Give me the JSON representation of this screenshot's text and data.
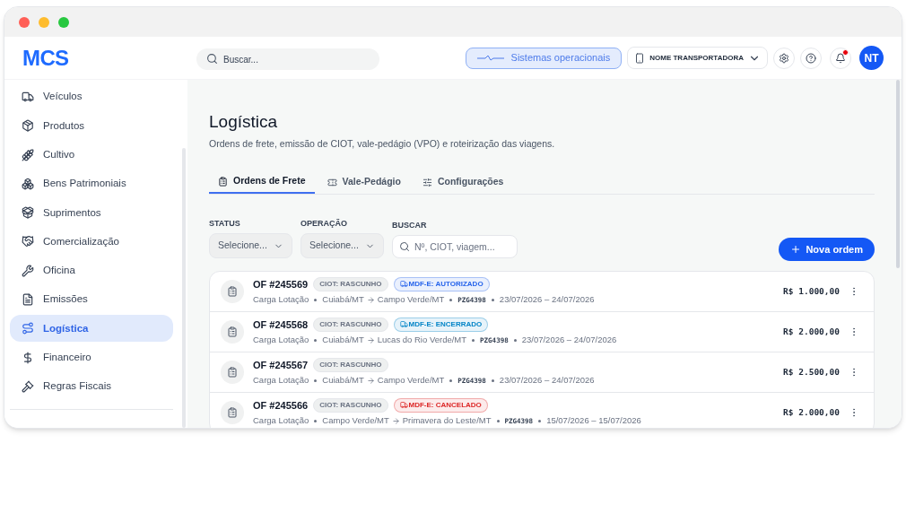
{
  "logo": "MCS",
  "header": {
    "search_placeholder": "Buscar...",
    "status_button": "Sistemas operacionais",
    "company": "NOME TRANSPORTADORA",
    "avatar": "NT",
    "has_notification": true
  },
  "sidebar": {
    "items": [
      {
        "label": "Veículos",
        "selected": false
      },
      {
        "label": "Produtos",
        "selected": false
      },
      {
        "label": "Cultivo",
        "selected": false
      },
      {
        "label": "Bens Patrimoniais",
        "selected": false
      },
      {
        "label": "Suprimentos",
        "selected": false
      },
      {
        "label": "Comercialização",
        "selected": false
      },
      {
        "label": "Oficina",
        "selected": false
      },
      {
        "label": "Emissões",
        "selected": false
      },
      {
        "label": "Logística",
        "selected": true
      },
      {
        "label": "Financeiro",
        "selected": false
      },
      {
        "label": "Regras Fiscais",
        "selected": false
      }
    ]
  },
  "page": {
    "title": "Logística",
    "subtitle": "Ordens de frete, emissão de CIOT, vale-pedágio (VPO) e roteirização das viagens."
  },
  "tabs": [
    {
      "label": "Ordens de Frete",
      "selected": true
    },
    {
      "label": "Vale-Pedágio",
      "selected": false
    },
    {
      "label": "Configurações",
      "selected": false
    }
  ],
  "filters": [
    {
      "label": "STATUS",
      "kind": "select",
      "placeholder": "Selecione..."
    },
    {
      "label": "OPERAÇÃO",
      "kind": "select",
      "placeholder": "Selecione..."
    },
    {
      "label": "BUSCAR",
      "kind": "search",
      "placeholder": "Nº, CIOT, viagem..."
    }
  ],
  "new_button": "Nova ordem",
  "orders": [
    {
      "number": "OF #245569",
      "ciot": "CIOT: RASCUNHO",
      "mdfe": {
        "label": "MDF-E: AUTORIZADO",
        "color": "#2563eb"
      },
      "type": "Carga Lotação",
      "origin": "Cuiabá/MT",
      "destination": "Campo Verde/MT",
      "plate": "PZG4398",
      "dates": "23/07/2026 – 24/07/2026",
      "amount": "R$ 1.000,00"
    },
    {
      "number": "OF #245568",
      "ciot": "CIOT: RASCUNHO",
      "mdfe": {
        "label": "MDF-E: ENCERRADO",
        "color": "#0284c7"
      },
      "type": "Carga Lotação",
      "origin": "Cuiabá/MT",
      "destination": "Lucas do Rio Verde/MT",
      "plate": "PZG4398",
      "dates": "23/07/2026 – 24/07/2026",
      "amount": "R$ 2.000,00"
    },
    {
      "number": "OF #245567",
      "ciot": "CIOT: RASCUNHO",
      "type": "Carga Lotação",
      "origin": "Cuiabá/MT",
      "destination": "Campo Verde/MT",
      "plate": "PZG4398",
      "dates": "23/07/2026 – 24/07/2026",
      "amount": "R$ 2.500,00"
    },
    {
      "number": "OF #245566",
      "ciot": "CIOT: RASCUNHO",
      "mdfe": {
        "label": "MDF-E: CANCELADO",
        "color": "#dc2626"
      },
      "type": "Carga Lotação",
      "origin": "Campo Verde/MT",
      "destination": "Primavera do Leste/MT",
      "plate": "PZG4398",
      "dates": "15/07/2026 – 15/07/2026",
      "amount": "R$ 2.000,00"
    }
  ]
}
